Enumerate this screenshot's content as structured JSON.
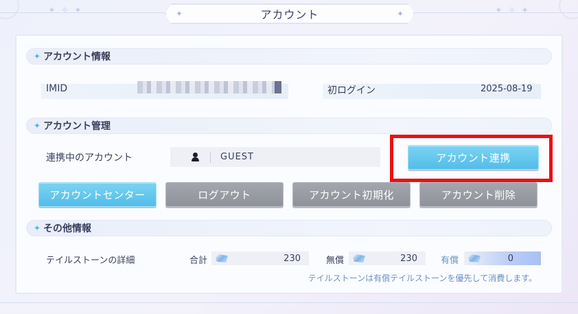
{
  "title": "アカウント",
  "decorations": {
    "left": "✦ ✧ ✦",
    "right": "✦ ✧ ✦",
    "title_spark": "✦"
  },
  "sections": {
    "account_info": {
      "header": "アカウント情報",
      "imid_label": "IMID",
      "first_login_label": "初ログイン",
      "first_login_value": "2025-08-19"
    },
    "account_management": {
      "header": "アカウント管理",
      "linked_label": "連携中のアカウント",
      "linked_value": "GUEST",
      "link_button": "アカウント連携",
      "buttons": {
        "center": "アカウントセンター",
        "logout": "ログアウト",
        "reset": "アカウント初期化",
        "delete": "アカウント削除"
      }
    },
    "other_info": {
      "header": "その他情報",
      "stone_detail_label": "テイルストーンの詳細",
      "total_label": "合計",
      "total_value": "230",
      "free_label": "無償",
      "free_value": "230",
      "paid_label": "有償",
      "paid_value": "0",
      "note": "テイルストーンは有償テイルストーンを優先して消費します。"
    }
  },
  "colors": {
    "accent_blue": "#52bde9",
    "button_gray": "#8f9299",
    "highlight_red": "#ea0f12",
    "paid_label": "#6c8fc9"
  },
  "icons": [
    "star-icon",
    "person-icon",
    "tailstone-icon"
  ]
}
